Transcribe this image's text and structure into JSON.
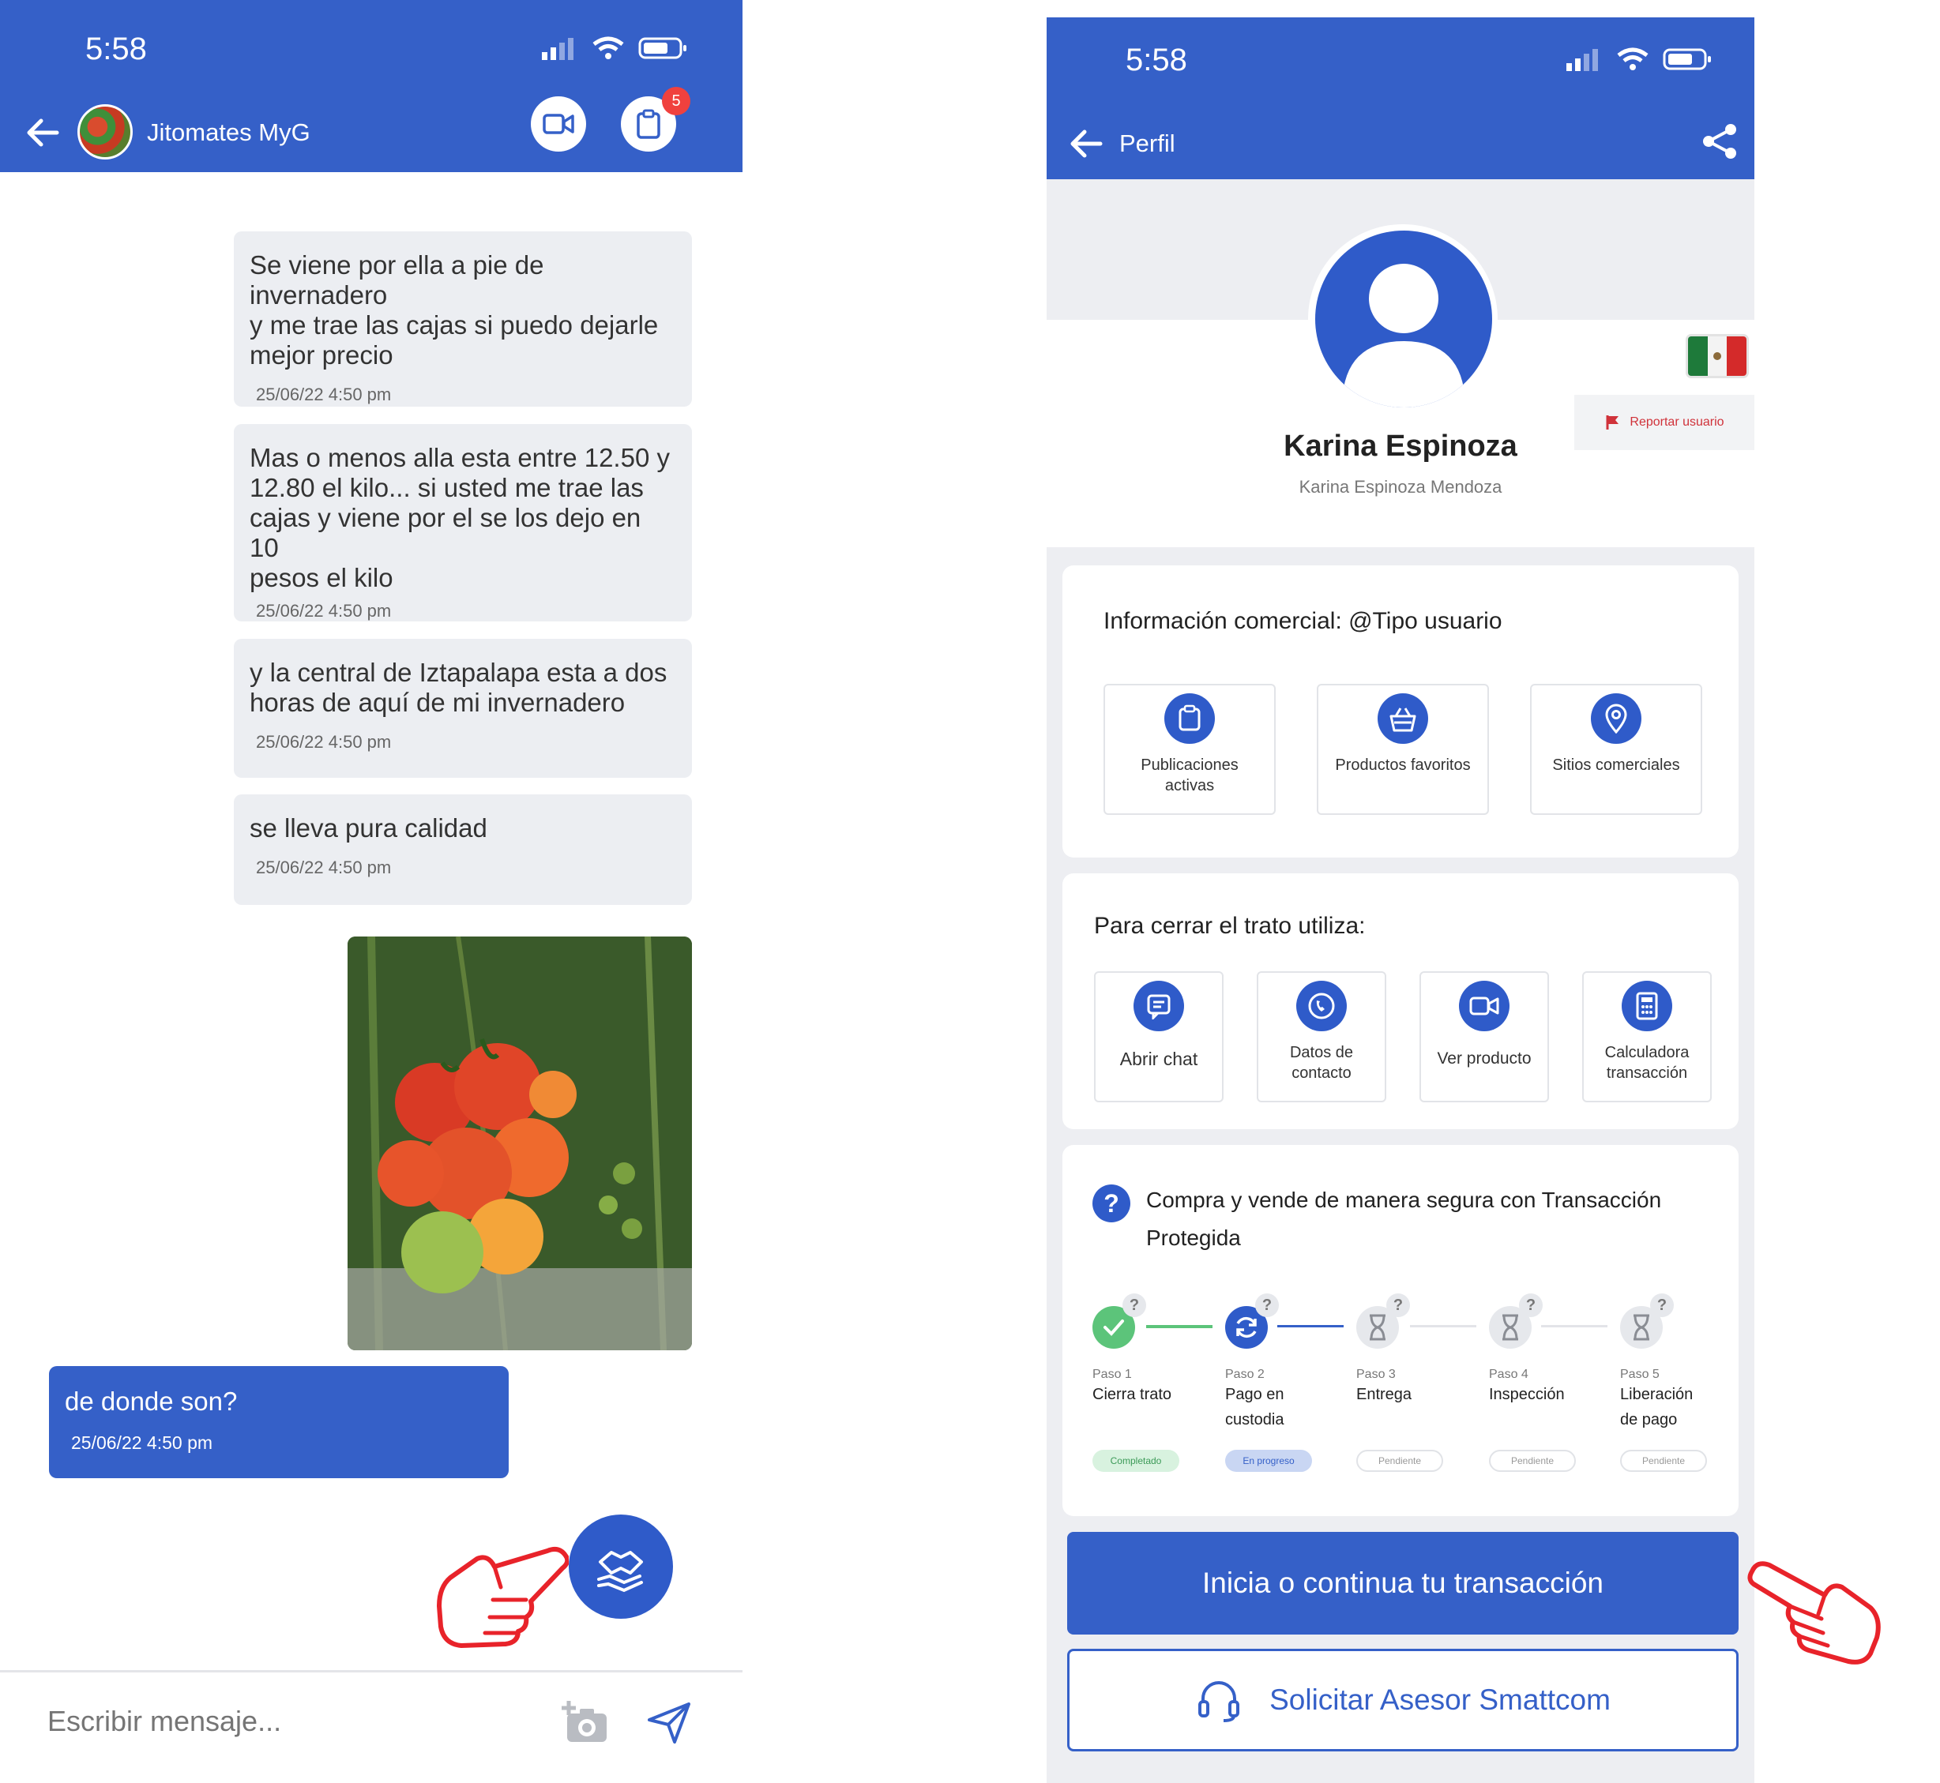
{
  "left": {
    "status": {
      "time": "5:58"
    },
    "header": {
      "contact_name": "Jitomates MyG",
      "notification_count": "5"
    },
    "messages": [
      {
        "text": "Se viene por ella a pie de invernadero\ny me trae las cajas si puedo dejarle\nmejor precio",
        "time": "25/06/22 4:50 pm"
      },
      {
        "text": "Mas o menos alla esta entre 12.50 y\n12.80 el kilo... si usted me trae las\ncajas y viene por el se los dejo en 10\npesos el kilo",
        "time": "25/06/22 4:50 pm"
      },
      {
        "text": "y la central de Iztapalapa esta a dos\nhoras de aquí de mi invernadero",
        "time": "25/06/22 4:50 pm"
      },
      {
        "text": "se lleva pura calidad",
        "time": "25/06/22 4:50 pm"
      }
    ],
    "outgoing": {
      "text": "de donde son?",
      "time": "25/06/22 4:50 pm"
    },
    "composer": {
      "placeholder": "Escribir mensaje..."
    }
  },
  "right": {
    "status": {
      "time": "5:58"
    },
    "header": {
      "title": "Perfil"
    },
    "profile": {
      "name": "Karina Espinoza",
      "full_name": "Karina Espinoza Mendoza",
      "report_label": "Reportar usuario"
    },
    "commercial": {
      "title": "Información comercial: @Tipo usuario",
      "tiles": [
        {
          "label": "Publicaciones\nactivas",
          "icon": "clipboard-icon"
        },
        {
          "label": "Productos favoritos",
          "icon": "basket-icon"
        },
        {
          "label": "Sitios comerciales",
          "icon": "location-pin-icon"
        }
      ]
    },
    "close_deal": {
      "title": "Para cerrar el trato utiliza:",
      "tiles": [
        {
          "label": "Abrir chat",
          "icon": "chat-icon"
        },
        {
          "label": "Datos de\ncontacto",
          "icon": "phone-icon"
        },
        {
          "label": "Ver producto",
          "icon": "video-icon"
        },
        {
          "label": "Calculadora\ntransacción",
          "icon": "calculator-icon"
        }
      ]
    },
    "protected": {
      "title_line1": "Compra y vende de manera segura con Transacción",
      "title_line2": "Protegida",
      "steps": [
        {
          "step": "Paso 1",
          "name": "Cierra trato",
          "status": "Completado"
        },
        {
          "step": "Paso 2",
          "name": "Pago en\ncustodia",
          "status": "En progreso"
        },
        {
          "step": "Paso 3",
          "name": "Entrega",
          "status": "Pendiente"
        },
        {
          "step": "Paso 4",
          "name": "Inspección",
          "status": "Pendiente"
        },
        {
          "step": "Paso 5",
          "name": "Liberación\nde pago",
          "status": "Pendiente"
        }
      ]
    },
    "primary_button": "Inicia o continua tu transacción",
    "secondary_button": "Solicitar Asesor Smattcom"
  },
  "colors": {
    "brand_blue": "#3560c8",
    "success_green": "#5cc47a",
    "hand_red": "#e8232a"
  }
}
